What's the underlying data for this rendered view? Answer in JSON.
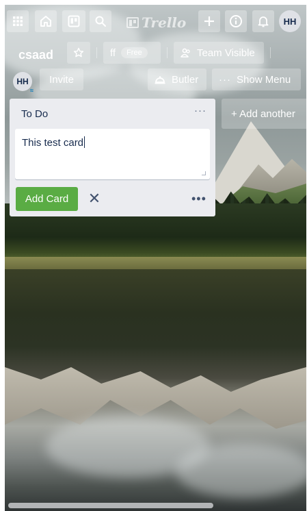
{
  "topbar": {
    "icons": [
      "apps-grid-icon",
      "home-icon",
      "boards-icon",
      "search-icon"
    ],
    "logo_text": "Trello",
    "actions": [
      "plus-icon",
      "info-icon",
      "bell-icon"
    ],
    "avatar_initials": "HH"
  },
  "board": {
    "name": "csaad",
    "team_name": "ff",
    "team_badge": "Free",
    "visibility_label": "Team Visible",
    "member_initials": "HH",
    "invite_label": "Invite",
    "butler_label": "Butler",
    "show_menu_label": "Show Menu"
  },
  "list": {
    "title": "To Do",
    "menu_glyph": "···",
    "composer_text": "This test card",
    "add_card_label": "Add Card",
    "close_glyph": "✕",
    "more_glyph": "•••"
  },
  "add_list": {
    "label": "+ Add another"
  },
  "colors": {
    "primary_button": "#5aac44",
    "list_bg": "#ebecf0",
    "text": "#172b4d"
  }
}
